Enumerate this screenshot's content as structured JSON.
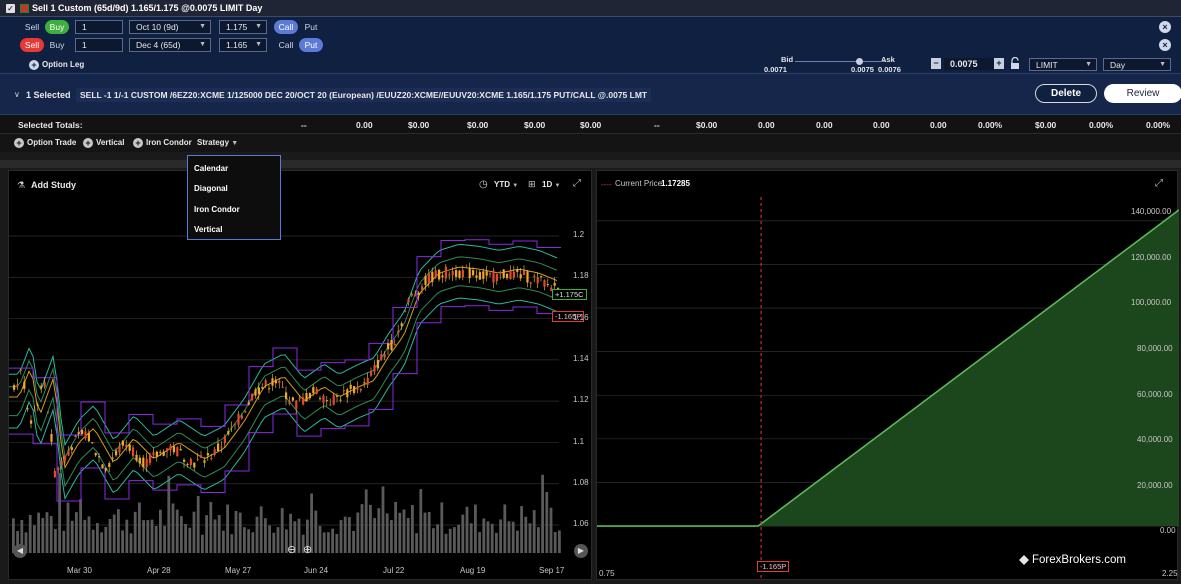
{
  "order": {
    "title": "Sell 1 Custom (65d/9d) 1.165/1.175 @0.0075 LIMIT Day",
    "legs": [
      {
        "side_sell": "Sell",
        "side_buy": "Buy",
        "active_side": "Buy",
        "qty": "1",
        "expiry": "Oct 10 (9d)",
        "strike": "1.175",
        "type_call": "Call",
        "type_put": "Put",
        "active_type": "Call"
      },
      {
        "side_sell": "Sell",
        "side_buy": "Buy",
        "active_side": "Sell",
        "qty": "1",
        "expiry": "Dec 4 (65d)",
        "strike": "1.165",
        "type_call": "Call",
        "type_put": "Put",
        "active_type": "Put"
      }
    ],
    "add_leg_label": "Option Leg",
    "bid_label": "Bid",
    "ask_label": "Ask",
    "bid_value": "0.0071",
    "mid_value": "0.0075",
    "ask_value": "0.0076",
    "price_value": "0.0075",
    "order_type": "LIMIT",
    "tif": "Day"
  },
  "summary": {
    "selected_label": "1 Selected",
    "description": "SELL -1 1/-1 CUSTOM /6EZ20:XCME 1/125000 DEC 20/OCT 20 (European) /EUUZ20:XCME//EUUV20:XCME 1.165/1.175 PUT/CALL @.0075 LMT",
    "delete_label": "Delete",
    "review_label": "Review"
  },
  "totals": {
    "label": "Selected Totals:",
    "values": [
      "--",
      "0.00",
      "$0.00",
      "$0.00",
      "$0.00",
      "$0.00",
      "--",
      "$0.00",
      "0.00",
      "0.00",
      "0.00",
      "0.00",
      "0.00%",
      "$0.00",
      "0.00%",
      "0.00%"
    ]
  },
  "add_row": {
    "option_trade": "Option Trade",
    "vertical": "Vertical",
    "iron_condor": "Iron Condor",
    "strategy": "Strategy"
  },
  "strategy_menu": [
    "Calendar",
    "Diagonal",
    "Iron Condor",
    "Vertical"
  ],
  "left_chart": {
    "add_study": "Add Study",
    "range": "YTD",
    "interval": "1D",
    "y_ticks": [
      "1.2",
      "1.18",
      "1.16",
      "1.14",
      "1.12",
      "1.1",
      "1.08",
      "1.06"
    ],
    "x_ticks": [
      "Mar 30",
      "Apr 28",
      "May 27",
      "Jun 24",
      "Jul 22",
      "Aug 19",
      "Sep 17"
    ],
    "call_tag": "+1.175C",
    "put_tag": "-1.165P"
  },
  "right_chart": {
    "current_price_label": "Current Price:",
    "current_price": "1.17285",
    "y_ticks": [
      "140,000.00",
      "120,000.00",
      "100,000.00",
      "80,000.00",
      "60,000.00",
      "40,000.00",
      "20,000.00",
      "0.00"
    ],
    "x_left": "0.75",
    "x_right": "2.25",
    "put_tag": "-1.165P",
    "watermark": "ForexBrokers.com"
  },
  "chart_data": {
    "type": "area",
    "title": "",
    "xlabel": "",
    "ylabel": "",
    "x": [
      0.75,
      1.165,
      2.25
    ],
    "y": [
      0,
      0,
      145000
    ],
    "xlim": [
      0.75,
      2.25
    ],
    "ylim": [
      -5000,
      150000
    ],
    "current_price": 1.17285,
    "colors": {
      "fill": "#1e4a1e",
      "line": "#5cb85c",
      "marker": "#e53935"
    }
  }
}
